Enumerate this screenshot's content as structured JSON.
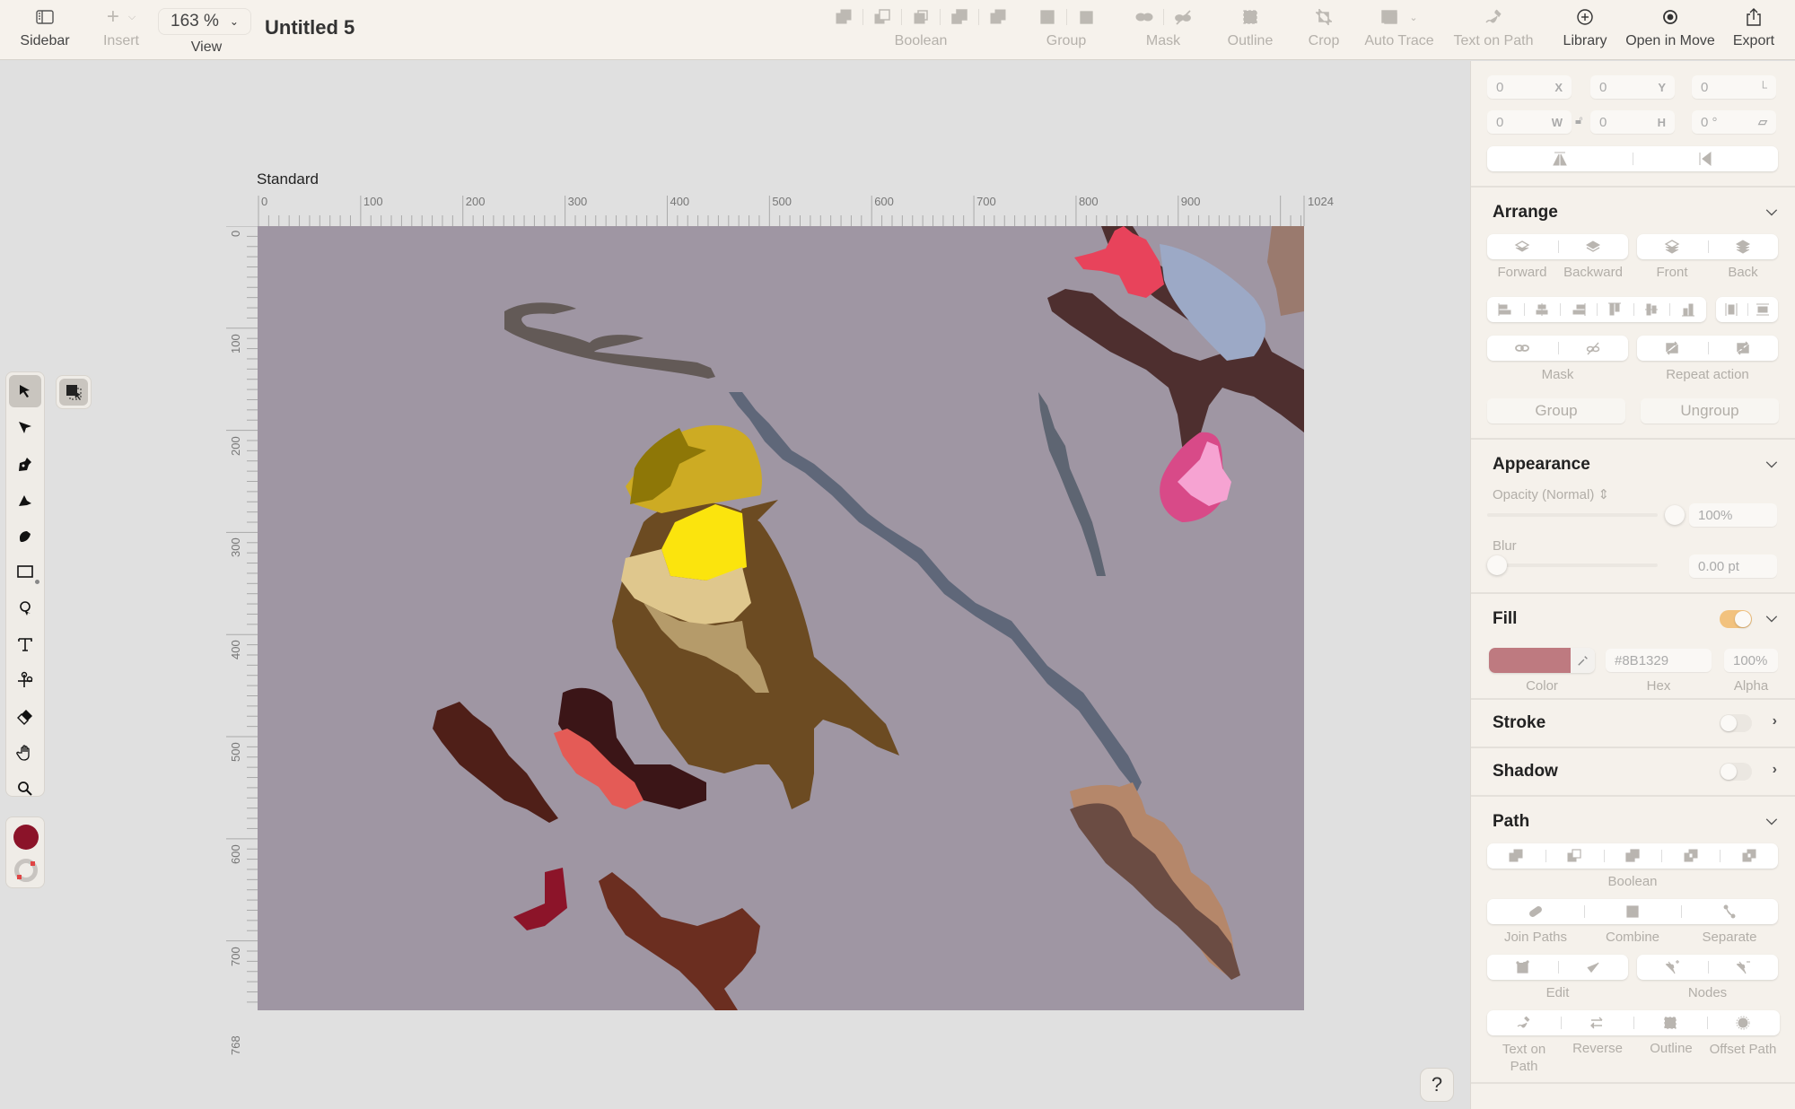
{
  "toolbar": {
    "sidebar_label": "Sidebar",
    "insert_label": "Insert",
    "zoom_value": "163 %",
    "view_label": "View",
    "document_title": "Untitled 5",
    "boolean_label": "Boolean",
    "group_label": "Group",
    "mask_label": "Mask",
    "outline_label": "Outline",
    "crop_label": "Crop",
    "auto_trace_label": "Auto Trace",
    "text_on_path_label": "Text on Path",
    "library_label": "Library",
    "open_in_move_label": "Open in Move",
    "export_label": "Export"
  },
  "canvas": {
    "artboard_name": "Standard",
    "ruler_top_ticks": [
      "0",
      "100",
      "200",
      "300",
      "400",
      "500",
      "600",
      "700",
      "800",
      "900",
      "1024"
    ],
    "ruler_left_ticks": [
      "0",
      "100",
      "200",
      "300",
      "400",
      "500",
      "600",
      "700",
      "768"
    ],
    "artboard_background": "#9f96a3",
    "help_label": "?"
  },
  "tools": [
    {
      "name": "select-tool",
      "active": true
    },
    {
      "name": "direct-select-tool"
    },
    {
      "name": "pen-tool"
    },
    {
      "name": "vector-brush-tool"
    },
    {
      "name": "brush-tool"
    },
    {
      "name": "rectangle-tool"
    },
    {
      "name": "lasso-tool"
    },
    {
      "name": "text-tool"
    },
    {
      "name": "scissors-tool"
    },
    {
      "name": "eraser-tool"
    },
    {
      "name": "hand-tool"
    },
    {
      "name": "zoom-tool"
    }
  ],
  "colors": {
    "fill": "#8B1329",
    "accent_toggle": "#F2C27E"
  },
  "panel": {
    "transform": {
      "x": {
        "value": "0",
        "tag": "X"
      },
      "y": {
        "value": "0",
        "tag": "Y"
      },
      "corner": {
        "value": "0"
      },
      "w": {
        "value": "0",
        "tag": "W"
      },
      "h": {
        "value": "0",
        "tag": "H"
      },
      "rotation": {
        "value": "0 °"
      }
    },
    "arrange": {
      "title": "Arrange",
      "order_labels": [
        "Forward",
        "Backward",
        "Front",
        "Back"
      ],
      "mask_label": "Mask",
      "repeat_label": "Repeat action",
      "group_button": "Group",
      "ungroup_button": "Ungroup"
    },
    "appearance": {
      "title": "Appearance",
      "opacity_label": "Opacity (Normal)",
      "opacity_value": "100%",
      "opacity_level": 1.0,
      "blur_label": "Blur",
      "blur_value": "0.00 pt",
      "blur_level": 0.0
    },
    "fill": {
      "title": "Fill",
      "enabled": true,
      "swatch_color": "#BE7A80",
      "hex_value": "#8B1329",
      "alpha_value": "100%",
      "color_label": "Color",
      "hex_label": "Hex",
      "alpha_label": "Alpha"
    },
    "stroke": {
      "title": "Stroke",
      "enabled": false
    },
    "shadow": {
      "title": "Shadow",
      "enabled": false
    },
    "path": {
      "title": "Path",
      "boolean_label": "Boolean",
      "join_label": "Join Paths",
      "combine_label": "Combine",
      "separate_label": "Separate",
      "edit_label": "Edit",
      "nodes_label": "Nodes",
      "text_on_path_label": "Text on Path",
      "reverse_label": "Reverse",
      "outline_label": "Outline",
      "offset_label": "Offset Path"
    }
  }
}
